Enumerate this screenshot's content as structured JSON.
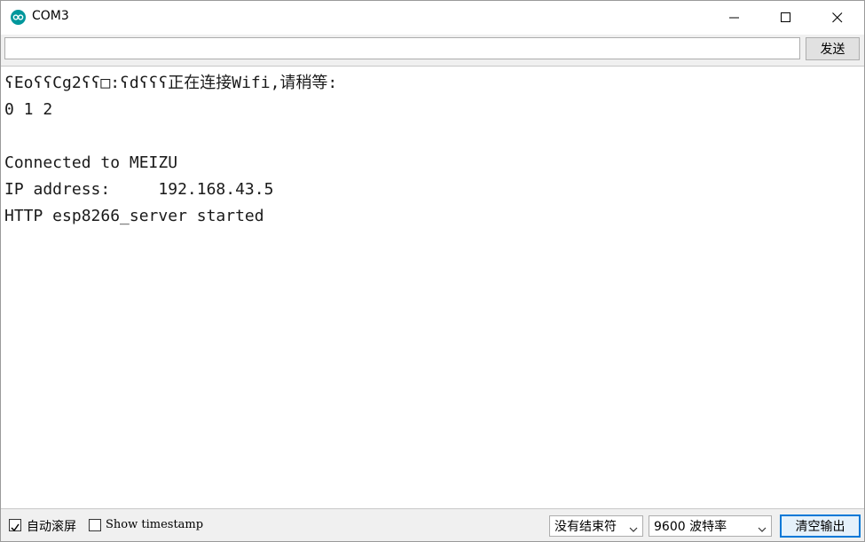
{
  "window": {
    "title": "COM3",
    "icon": "arduino-icon",
    "controls": [
      "minimize-icon",
      "maximize-icon",
      "close-icon"
    ]
  },
  "send": {
    "input_value": "",
    "button_label": "发送"
  },
  "output": {
    "lines": [
      "ʕEoʕʕCg2ʕʕ□:ʕdʕʕʕ正在连接Wifi,请稍等:",
      "0 1 2",
      "",
      "Connected to MEIZU",
      "IP address:     192.168.43.5",
      "HTTP esp8266_server started"
    ]
  },
  "statusbar": {
    "autoscroll_label": "自动滚屏",
    "autoscroll_checked": true,
    "timestamp_label": "Show timestamp",
    "timestamp_checked": false,
    "line_ending": "没有结束符",
    "baud_rate": "9600 波特率",
    "clear_label": "清空输出"
  },
  "colors": {
    "accent": "#0078d7",
    "icon": "#00979c"
  }
}
